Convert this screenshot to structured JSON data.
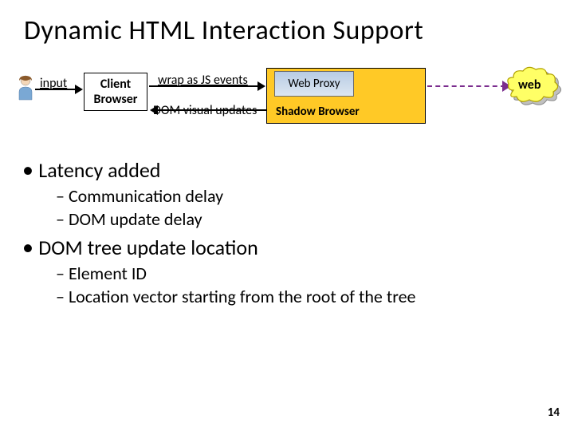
{
  "title": "Dynamic HTML Interaction Support",
  "diagram": {
    "input_label": "input",
    "client_line1": "Client",
    "client_line2": "Browser",
    "wrap_label": "wrap as JS events",
    "dom_label": "DOM visual updates",
    "proxy_label": "Web Proxy",
    "shadow_label": "Shadow Browser",
    "web_label": "web"
  },
  "bullets": {
    "b1": "Latency added",
    "b1s1": "Communication delay",
    "b1s2": "DOM update delay",
    "b2": "DOM tree update location",
    "b2s1": "Element ID",
    "b2s2": "Location vector starting from the root of the tree"
  },
  "slide_number": "14"
}
